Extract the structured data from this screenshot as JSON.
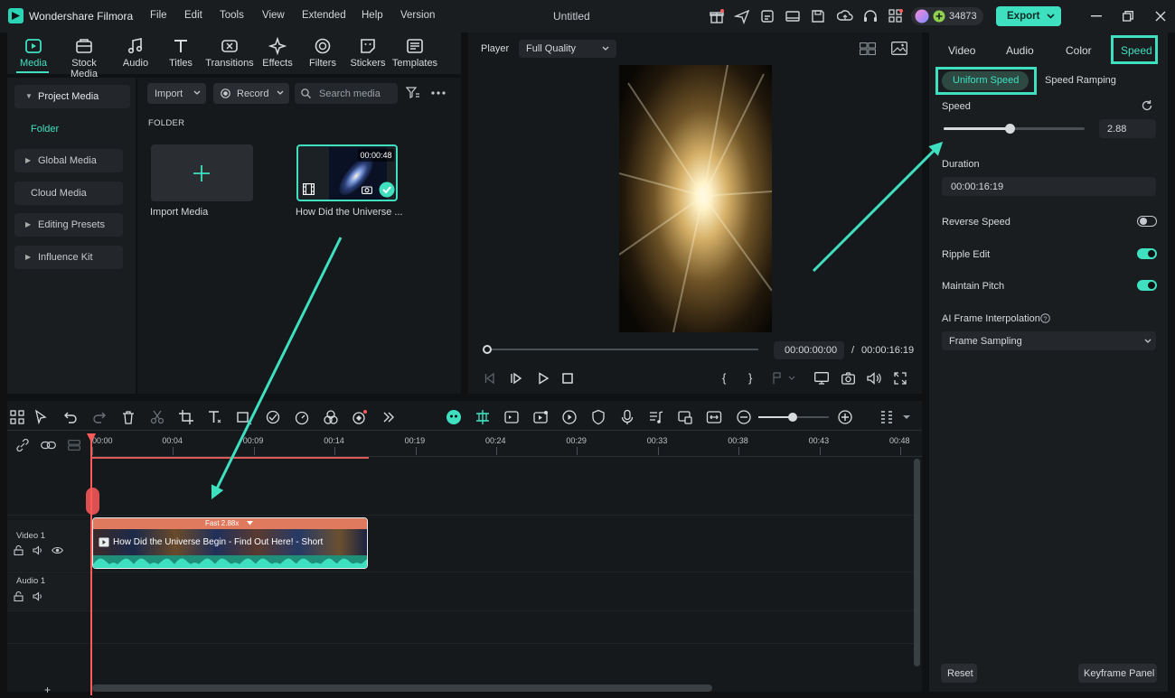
{
  "app": {
    "name": "Wondershare Filmora",
    "doc_title": "Untitled",
    "credits": "34873",
    "export": "Export"
  },
  "menu": [
    "File",
    "Edit",
    "Tools",
    "View",
    "Extended",
    "Help",
    "Version"
  ],
  "media_tabs": [
    "Media",
    "Stock Media",
    "Audio",
    "Titles",
    "Transitions",
    "Effects",
    "Filters",
    "Stickers",
    "Templates"
  ],
  "sidebar": {
    "project_media": "Project Media",
    "folder": "Folder",
    "global_media": "Global Media",
    "cloud_media": "Cloud Media",
    "editing_presets": "Editing Presets",
    "influence_kit": "Influence Kit"
  },
  "media": {
    "import": "Import",
    "record": "Record",
    "search_placeholder": "Search media",
    "folder_heading": "FOLDER",
    "import_tile": "Import Media",
    "clip_duration": "00:00:48",
    "clip_name": "How Did the Universe ..."
  },
  "player": {
    "label": "Player",
    "quality": "Full Quality",
    "current_time": "00:00:00:00",
    "separator": "/",
    "total_time": "00:00:16:19",
    "progress": 0
  },
  "right_panel": {
    "tabs": [
      "Video",
      "Audio",
      "Color",
      "Speed"
    ],
    "active_tab": "Speed",
    "modes": {
      "uniform": "Uniform Speed",
      "ramping": "Speed Ramping"
    },
    "speed_label": "Speed",
    "speed_value": "2.88",
    "speed_slider_fraction": 0.47,
    "duration_label": "Duration",
    "duration_value": "00:00:16:19",
    "reverse_speed": {
      "label": "Reverse Speed",
      "on": false
    },
    "ripple_edit": {
      "label": "Ripple Edit",
      "on": true
    },
    "maintain_pitch": {
      "label": "Maintain Pitch",
      "on": true
    },
    "ai_interp_label": "AI Frame Interpolation",
    "ai_interp_value": "Frame Sampling",
    "reset": "Reset",
    "keyframe_panel": "Keyframe Panel"
  },
  "timeline": {
    "ticks": [
      "00:00",
      "00:04",
      "00:09",
      "00:14",
      "00:19",
      "00:24",
      "00:29",
      "00:33",
      "00:38",
      "00:43",
      "00:48"
    ],
    "video_track": "Video 1",
    "audio_track": "Audio 1",
    "clip_speed_badge": "Fast 2.88x",
    "clip_title": "How Did the Universe Begin - Find Out Here! - Short"
  },
  "colors": {
    "accent": "#3ee0c0",
    "clip_header": "#e07a5f",
    "playhead": "#ff5a5a"
  }
}
